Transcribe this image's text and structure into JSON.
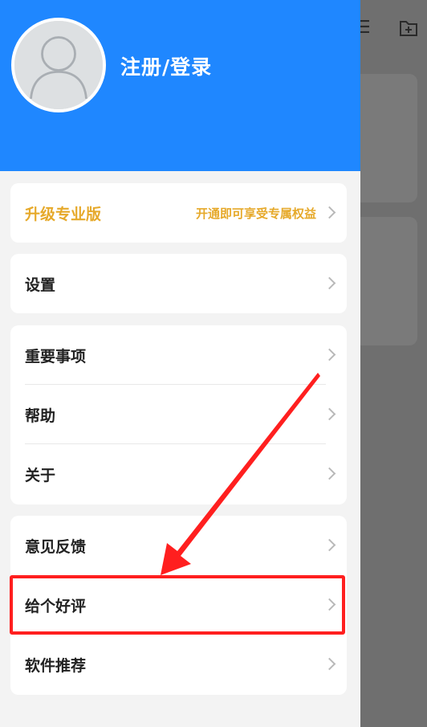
{
  "header": {
    "login_label": "注册/登录"
  },
  "pro": {
    "label": "升级专业版",
    "subtitle": "开通即可享受专属权益"
  },
  "menu": {
    "settings": "设置",
    "important": "重要事项",
    "help": "帮助",
    "about": "关于",
    "feedback": "意见反馈",
    "rate": "给个好评",
    "recommend": "软件推荐"
  },
  "colors": {
    "header_bg": "#1f87ff",
    "pro_accent": "#e6a92a",
    "highlight": "#ff1f1f",
    "arrow": "#ff1f1f"
  },
  "icons": {
    "avatar": "user-avatar-icon",
    "chevron": "chevron-right-icon",
    "background_menu": "menu-icon",
    "background_folder": "new-folder-icon"
  }
}
